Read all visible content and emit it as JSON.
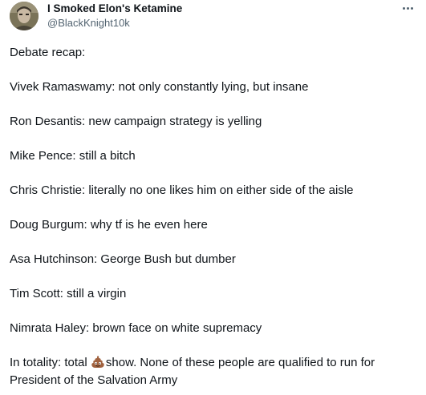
{
  "tweet": {
    "author": {
      "display_name": "I Smoked Elon's Ketamine",
      "handle": "@BlackKnight10k"
    },
    "more_icon": "more-horizontal-icon",
    "lines": [
      "Debate recap:",
      "Vivek Ramaswamy:  not only constantly lying, but insane",
      "Ron Desantis: new campaign strategy is yelling",
      "Mike Pence: still a bitch",
      "Chris Christie: literally no one likes him on either side of the aisle",
      "Doug Burgum: why tf is he even here",
      "Asa Hutchinson: George Bush but dumber",
      "Tim Scott: still a virgin",
      "Nimrata Haley:  brown face on white supremacy"
    ],
    "final": {
      "prefix": "In totality: total ",
      "emoji": "pile-of-poo-emoji",
      "suffix": "show. None of these people are qualified to run for President of the Salvation Army"
    }
  }
}
